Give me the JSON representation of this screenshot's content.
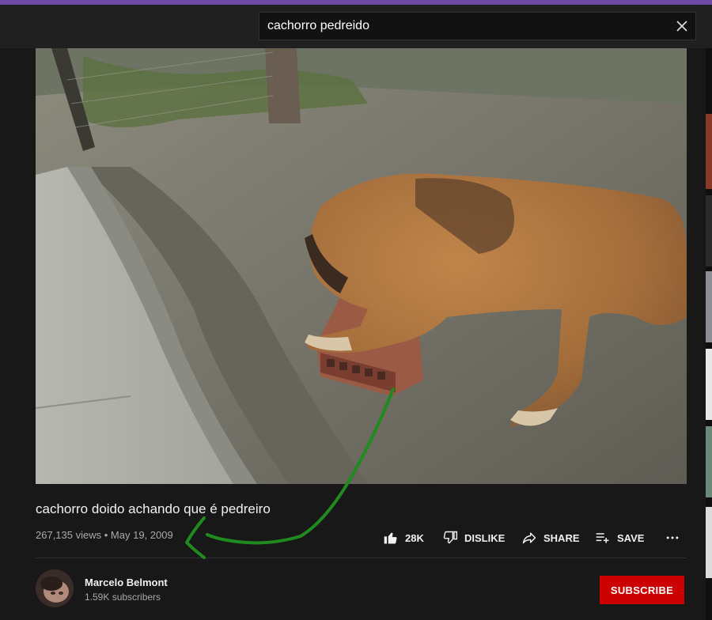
{
  "search": {
    "query": "cachorro pedreido"
  },
  "video": {
    "title": "cachorro doido achando que é pedreiro",
    "views": "267,135 views",
    "date": "May 19, 2009"
  },
  "actions": {
    "like_count": "28K",
    "dislike_label": "DISLIKE",
    "share_label": "SHARE",
    "save_label": "SAVE"
  },
  "channel": {
    "name": "Marcelo Belmont",
    "subscribers": "1.59K subscribers"
  },
  "subscribe_label": "SUBSCRIBE",
  "colors": {
    "background": "#181818",
    "header": "#202020",
    "accent_strip": "#6f4aa8",
    "subscribe": "#cc0000",
    "annotation": "#1f8a1f"
  }
}
